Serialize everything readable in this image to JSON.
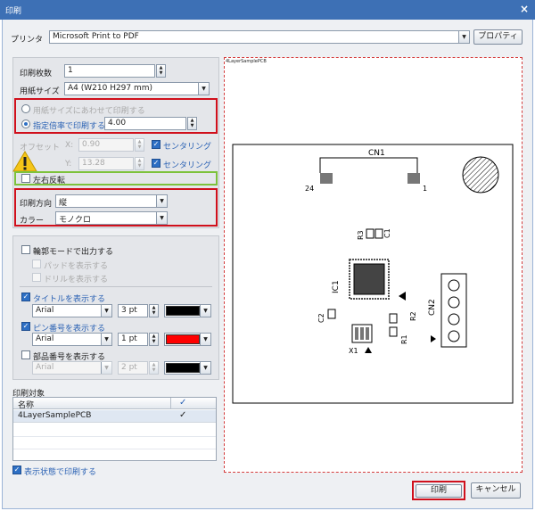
{
  "window": {
    "title": "印刷",
    "close": "×"
  },
  "printer": {
    "label": "プリンタ",
    "value": "Microsoft Print to PDF",
    "properties_button": "プロパティ"
  },
  "copies": {
    "label": "印刷枚数",
    "value": "1"
  },
  "paper": {
    "label": "用紙サイズ",
    "value": "A4 (W210 H297 mm)"
  },
  "scale": {
    "fit_label": "用紙サイズにあわせて印刷する",
    "ratio_label": "指定倍率で印刷する",
    "ratio_value": "4.00"
  },
  "offset": {
    "label": "オフセット",
    "x_label": "X:",
    "x_value": "0.90",
    "y_label": "Y:",
    "y_value": "13.28",
    "center_label": "センタリング"
  },
  "mirror": {
    "label": "左右反転"
  },
  "orientation": {
    "label": "印刷方向",
    "value": "縦"
  },
  "color": {
    "label": "カラー",
    "value": "モノクロ"
  },
  "outline": {
    "label": "輪郭モードで出力する",
    "pads_label": "パッドを表示する",
    "drills_label": "ドリルを表示する"
  },
  "title_opt": {
    "label": "タイトルを表示する",
    "font": "Arial",
    "size": "3 pt",
    "color": "#000000"
  },
  "pin_opt": {
    "label": "ピン番号を表示する",
    "font": "Arial",
    "size": "1 pt",
    "color": "#ff0000"
  },
  "part_opt": {
    "label": "部品番号を表示する",
    "font": "Arial",
    "size": "2 pt",
    "color": "#000000"
  },
  "target": {
    "label": "印刷対象",
    "col_name": "名称",
    "col_check": "✓",
    "rows": [
      {
        "name": "4LayerSamplePCB",
        "check": "✓"
      }
    ]
  },
  "print_as_shown": {
    "label": "表示状態で印刷する"
  },
  "preview": {
    "page_title": "4LayerSamplePCB",
    "labels": {
      "cn1": "CN1",
      "pin24": "24",
      "pin1": "1",
      "r3": "R3",
      "c1": "C1",
      "ic1": "IC1",
      "cn2": "CN2",
      "c2": "C2",
      "r2": "R2",
      "r1": "R1",
      "x1": "X1"
    }
  },
  "buttons": {
    "print": "印刷",
    "cancel": "キャンセル"
  },
  "icons": {
    "warning": "warning-icon",
    "dropdown": "chevron-down-icon"
  }
}
